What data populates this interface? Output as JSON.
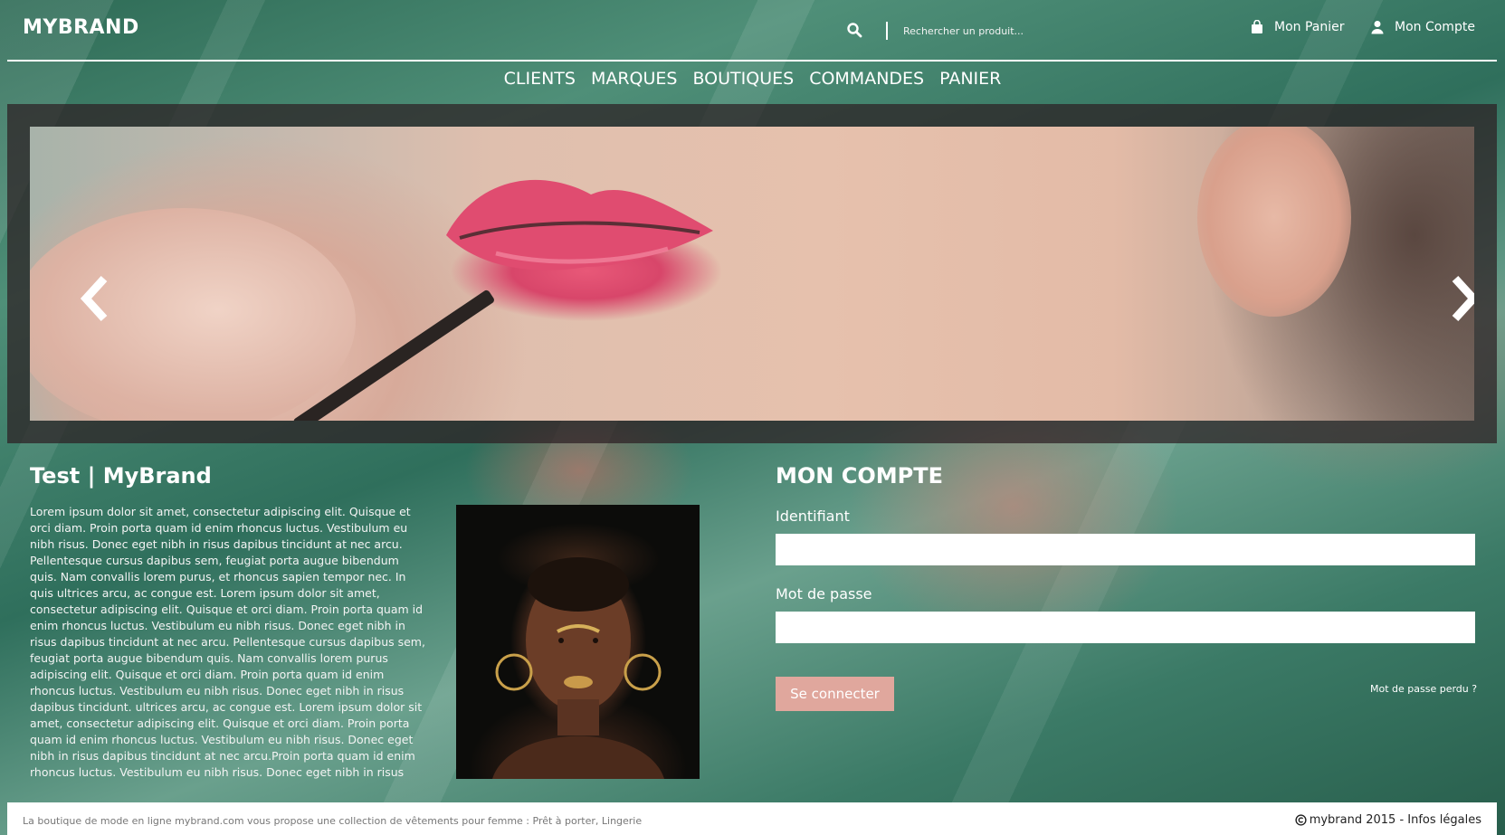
{
  "header": {
    "brand": "MYBRAND",
    "search": {
      "icon": "search-icon",
      "placeholder": "Rechercher un produit..."
    },
    "cart": {
      "label": "Mon Panier",
      "icon": "shopping-bag-icon"
    },
    "account": {
      "label": "Mon Compte",
      "icon": "user-icon"
    }
  },
  "nav": {
    "items": [
      {
        "label": "CLIENTS"
      },
      {
        "label": "MARQUES"
      },
      {
        "label": "BOUTIQUES"
      },
      {
        "label": "COMMANDES"
      },
      {
        "label": "PANIER"
      }
    ]
  },
  "carousel": {
    "prev_icon": "chevron-left-icon",
    "next_icon": "chevron-right-icon"
  },
  "about": {
    "title": "Test | MyBrand",
    "text": "Lorem ipsum dolor sit amet, consectetur adipiscing elit. Quisque et orci diam. Proin porta quam id enim rhoncus luctus. Vestibulum eu nibh risus. Donec eget nibh in risus dapibus tincidunt at nec arcu. Pellentesque cursus dapibus sem, feugiat porta augue bibendum quis. Nam convallis lorem purus, et rhoncus sapien tempor nec. In quis ultrices arcu, ac congue est. Lorem ipsum dolor sit amet, consectetur adipiscing elit. Quisque et orci diam. Proin porta quam id enim rhoncus luctus. Vestibulum eu nibh risus. Donec eget nibh in risus dapibus tincidunt at nec arcu. Pellentesque cursus dapibus sem, feugiat porta augue bibendum quis. Nam convallis lorem purus adipiscing elit. Quisque et orci diam. Proin porta quam id enim rhoncus luctus. Vestibulum eu nibh risus. Donec eget nibh in risus dapibus tincidunt. ultrices arcu, ac congue est. Lorem ipsum dolor sit amet, consectetur adipiscing elit. Quisque et orci diam. Proin porta quam id enim rhoncus luctus. Vestibulum eu nibh risus. Donec eget nibh in risus dapibus tincidunt at nec arcu.Proin porta quam id enim rhoncus luctus. Vestibulum eu nibh risus. Donec eget nibh in risus dapibus tincidunt. ultrices arcu, ac congue est. Lorem ipsum dolor sit amet, consectetur adipiscing elit. Quisq..."
  },
  "login": {
    "title": "MON COMPTE",
    "identifier_label": "Identifiant",
    "identifier_value": "",
    "password_label": "Mot de passe",
    "password_value": "",
    "submit_label": "Se connecter",
    "forgot_label": "Mot de passe perdu ?"
  },
  "footer": {
    "description": "La boutique de mode en ligne mybrand.com vous propose une collection de vêtements pour femme : Prêt à porter, Lingerie",
    "copyright_icon": "copyright-icon",
    "copyright": "mybrand 2015 - Infos légales"
  },
  "colors": {
    "accent_button": "#e0a79d",
    "text": "#ffffff",
    "carousel_frame": "#2d1e23",
    "footer_background": "#ffffff"
  }
}
